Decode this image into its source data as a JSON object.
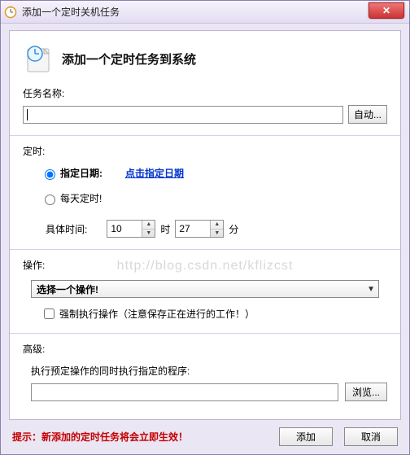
{
  "window": {
    "title": "添加一个定时关机任务"
  },
  "header": {
    "title": "添加一个定时任务到系统"
  },
  "task_name": {
    "label": "任务名称:",
    "value": "",
    "auto_btn": "自动..."
  },
  "timing": {
    "section": "定时:",
    "date_radio": "指定日期:",
    "date_link": "点击指定日期",
    "daily_radio": "每天定时!",
    "time_label": "具体时间:",
    "hour": "10",
    "hour_unit": "时",
    "minute": "27",
    "minute_unit": "分"
  },
  "action": {
    "section": "操作:",
    "combo_value": "选择一个操作!",
    "force_check": "强制执行操作（注意保存正在进行的工作！）"
  },
  "advanced": {
    "section": "高级:",
    "run_label": "执行预定操作的同时执行指定的程序:",
    "path": "",
    "browse_btn": "浏览..."
  },
  "footer": {
    "hint": "提示：新添加的定时任务将会立即生效！",
    "add": "添加",
    "cancel": "取消"
  },
  "watermark": "http://blog.csdn.net/kflizcst"
}
